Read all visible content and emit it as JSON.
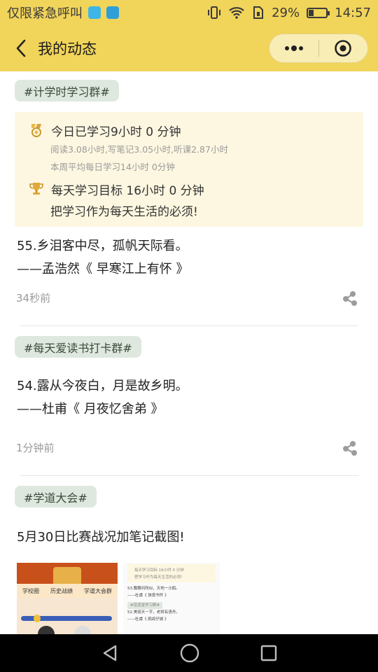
{
  "status_bar": {
    "carrier": "仅限紧急呼叫",
    "battery": "29%",
    "time": "14:57",
    "icons": [
      "app-icon-blue",
      "app-icon-picture",
      "vibrate-icon",
      "wifi-icon",
      "sim-icon",
      "battery-icon"
    ]
  },
  "header": {
    "title": "我的动态",
    "back_icon": "chevron-left-icon",
    "menu_icon": "more-dots-icon",
    "close_icon": "target-circle-icon"
  },
  "colors": {
    "header_bg": "#f1d45a",
    "tag_bg": "#dfe8df",
    "card_bg": "#fdf7e1",
    "muted_text": "#9a9a9a"
  },
  "posts": [
    {
      "tag": "#计学时学习群#",
      "study_card": {
        "today": "今日已学习9小时 0 分钟",
        "breakdown": "阅读3.08小时,写笔记3.05小时,听课2.87小时",
        "weekly": "本周平均每日学习14小时 0分钟",
        "goal": "每天学习目标 16小时 0 分钟",
        "motto": "把学习作为每天生活的必须!"
      },
      "line1": "55.乡泪客中尽，孤帆天际看。",
      "line2": "——孟浩然《 早寒江上有怀 》",
      "time": "34秒前"
    },
    {
      "tag": "#每天爱读书打卡群#",
      "line1": "54.露从今夜白，月是故乡明。",
      "line2": "——杜甫《 月夜忆舍弟 》",
      "time": "1分钟前"
    },
    {
      "tag": "#学道大会#",
      "line1": "5月30日比赛战况加笔记截图!",
      "thumb1": {
        "tabs": [
          "学校圈",
          "历史战绩",
          "学道大会群"
        ]
      },
      "thumb2": {
        "lines": [
          "每天学习目标 16小时 0 分钟",
          "把学习作为每天生活的必须!",
          "53.飘飘何所似，天地一沙鸥。",
          "——杜甫《 旅夜书怀 》",
          "#道道堂学习群#",
          "52.美丽天一字，老将有语舟。",
          "——杜甫《 鹧鸪仔城 》"
        ]
      }
    }
  ],
  "nav_bar": {
    "icons": [
      "back-triangle-icon",
      "home-circle-icon",
      "recents-square-icon"
    ]
  }
}
